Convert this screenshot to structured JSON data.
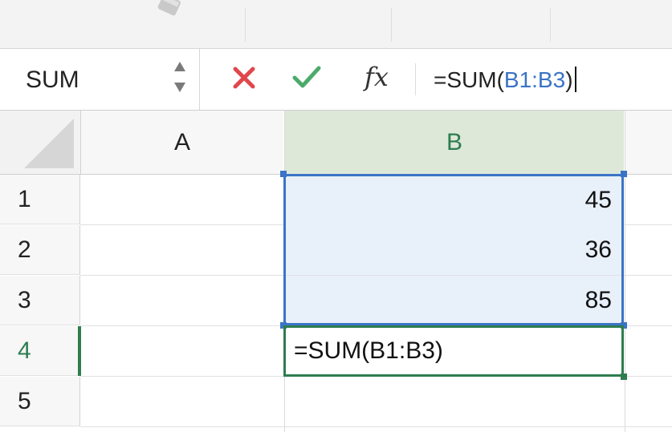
{
  "formula_bar": {
    "name_box": "SUM",
    "formula_prefix": "=SUM(",
    "formula_ref": "B1:B3",
    "formula_suffix": ")",
    "fx_label": "fx"
  },
  "columns": [
    "A",
    "B"
  ],
  "rows": [
    "1",
    "2",
    "3",
    "4",
    "5"
  ],
  "cells": {
    "B1": "45",
    "B2": "36",
    "B3": "85",
    "B4": "=SUM(B1:B3)"
  },
  "colors": {
    "range_blue": "#3b74c7",
    "active_green": "#2e7d4f",
    "cancel_red": "#e0474c",
    "enter_green": "#4cab6a"
  },
  "icons": [
    "paint-format-icon",
    "stepper-icon",
    "cancel-icon",
    "enter-icon",
    "fx-icon"
  ]
}
